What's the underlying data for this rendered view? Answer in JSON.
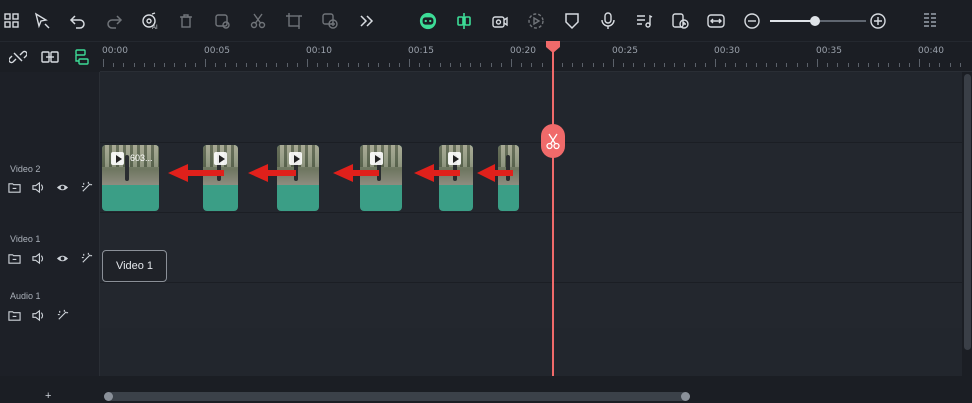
{
  "toolbar": {
    "icons": [
      "layout-grid-icon",
      "select-cursor-icon",
      "undo-icon",
      "redo-icon",
      "ai-audio-icon",
      "delete-icon",
      "crop-icon",
      "cut-icon",
      "transform-icon",
      "text-speech-icon",
      "more-tools-icon",
      "ai-mascot-icon",
      "snap-magnet-icon",
      "record-screen-icon",
      "render-preview-icon",
      "marker-shield-icon",
      "voiceover-mic-icon",
      "audio-list-icon",
      "auto-ripple-icon",
      "fit-width-icon",
      "zoom-out-icon",
      "zoom-in-icon",
      "panel-settings-icon"
    ],
    "zoom_level": 0.47,
    "accent_color": "#3ddc97"
  },
  "ruler": {
    "labels": [
      "00:00",
      "00:05",
      "00:10",
      "00:15",
      "00:20",
      "00:25",
      "00:30",
      "00:35",
      "00:40"
    ]
  },
  "tracks": {
    "video2": {
      "label": "Video 2"
    },
    "video1": {
      "label": "Video 1"
    },
    "audio1": {
      "label": "Audio 1"
    }
  },
  "clips": {
    "first_name": "603..."
  },
  "tooltip": {
    "text": "Video 1"
  },
  "bottom": {
    "add_symbol": "+"
  },
  "colors": {
    "playhead": "#f06a6a",
    "clip": "#3b9e86",
    "arrow": "#e0201b"
  }
}
